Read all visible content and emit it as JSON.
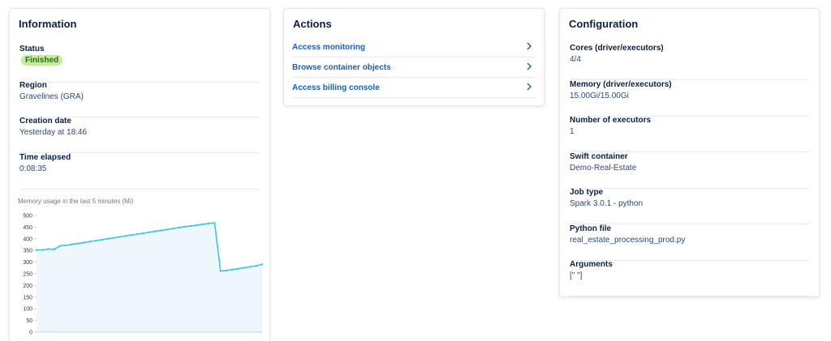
{
  "information": {
    "title": "Information",
    "status": {
      "label": "Status",
      "badge": "Finished",
      "badge_color": "#c6eb9f"
    },
    "region": {
      "label": "Region",
      "value": "Gravelines (GRA)"
    },
    "creation_date": {
      "label": "Creation date",
      "value": "Yesterday at 18:46"
    },
    "time_elapsed": {
      "label": "Time elapsed",
      "value": "0:08:35"
    }
  },
  "actions": {
    "title": "Actions",
    "items": [
      {
        "label": "Access monitoring",
        "icon": "chevron-right-icon"
      },
      {
        "label": "Browse container objects",
        "icon": "chevron-right-icon"
      },
      {
        "label": "Access billing console",
        "icon": "chevron-right-icon"
      }
    ]
  },
  "configuration": {
    "title": "Configuration",
    "fields": [
      {
        "label": "Cores (driver/executors)",
        "value": "4/4"
      },
      {
        "label": "Memory (driver/executors)",
        "value": "15.00Gi/15.00Gi"
      },
      {
        "label": "Number of executors",
        "value": "1"
      },
      {
        "label": "Swift container",
        "value": "Demo-Real-Estate"
      },
      {
        "label": "Job type",
        "value": "Spark 3.0.1 - python"
      },
      {
        "label": "Python file",
        "value": "real_estate_processing_prod.py"
      },
      {
        "label": "Arguments",
        "value": "[\" \"]"
      }
    ]
  },
  "colors": {
    "accent": "#1a5fc4",
    "line": "#3ec4e6",
    "area": "#eef7fc",
    "title": "#0a1f44"
  },
  "chart_data": {
    "type": "area",
    "title": "Memory usage in the last 5 minutes (Mi)",
    "xlabel": "",
    "ylabel": "",
    "ylim": [
      0,
      500
    ],
    "yticks": [
      0,
      50,
      100,
      150,
      200,
      250,
      300,
      350,
      400,
      450,
      500
    ],
    "grid": false,
    "series": [
      {
        "values": [
          352,
          352,
          356,
          355,
          370,
          372,
          376,
          380,
          384,
          388,
          392,
          396,
          400,
          404,
          408,
          412,
          416,
          420,
          424,
          428,
          432,
          436,
          440,
          444,
          448,
          452,
          455,
          458,
          462,
          466,
          468,
          262,
          264,
          268,
          272,
          276,
          280,
          284,
          290
        ]
      }
    ]
  }
}
